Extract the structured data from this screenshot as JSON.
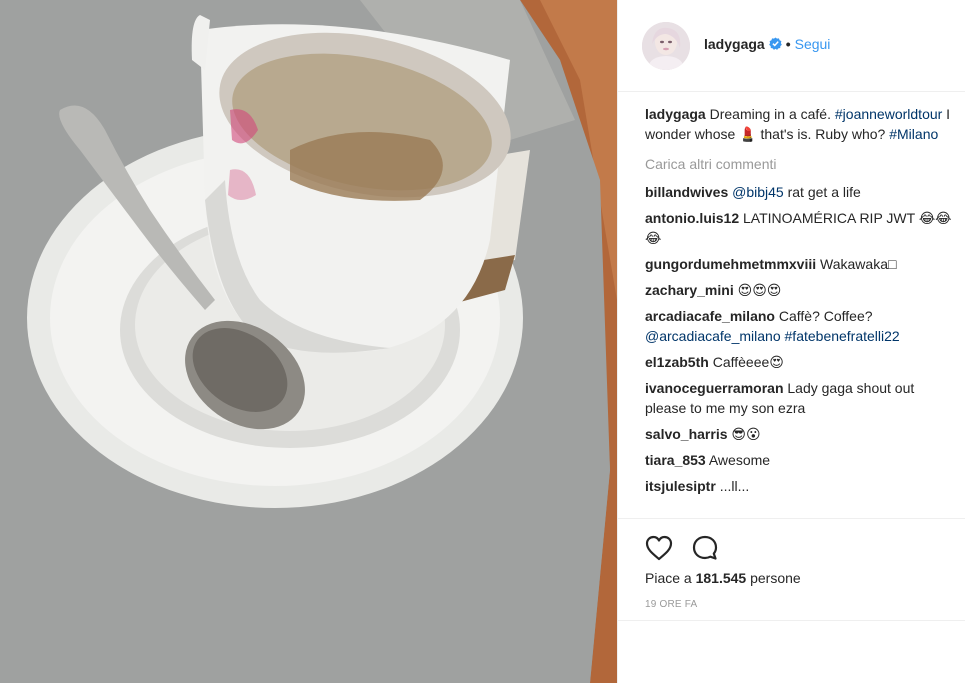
{
  "post": {
    "username": "ladygaga",
    "separator": "•",
    "follow_label": "Segui",
    "caption": {
      "username": "ladygaga",
      "text_before": "Dreaming in a café. ",
      "hashtag1": "#joanneworldtour",
      "text_middle": " I wonder whose 💄 that's is. Ruby who? ",
      "hashtag2": "#Milano"
    },
    "load_more_label": "Carica altri commenti",
    "comments": [
      {
        "user": "billandwives",
        "mention": "@bibj45",
        "text": " rat get a life"
      },
      {
        "user": "antonio.luis12",
        "text": "LATINOAMÉRICA RIP JWT 😂😂😂"
      },
      {
        "user": "gungordumehmetmmxviii",
        "text": "Wakawaka□"
      },
      {
        "user": "zachary_mini",
        "text": "😍😍😍"
      },
      {
        "user": "arcadiacafe_milano",
        "text": "Caffè? Coffee? ",
        "mention": "@arcadiacafe_milano",
        "hashtag": " #fatebenefratelli22"
      },
      {
        "user": "el1zab5th",
        "text": "Caffèeee😍"
      },
      {
        "user": "ivanoceguerramoran",
        "text": "Lady gaga shout out please to me my son ezra"
      },
      {
        "user": "salvo_harris",
        "text": "😎😮"
      },
      {
        "user": "tiara_853",
        "text": "Awesome"
      },
      {
        "user": "itsjulesiptr",
        "text": "...ll..."
      }
    ],
    "likes_prefix": "Piace a ",
    "likes_count": "181.545",
    "likes_suffix": " persone",
    "timestamp": "19 ORE FA"
  },
  "colors": {
    "link": "#3897f0",
    "hashtag": "#003569",
    "muted": "#999999",
    "border": "#efefef"
  },
  "icons": {
    "like": "heart-outline-icon",
    "comment": "speech-bubble-icon",
    "verified": "verified-badge-icon"
  }
}
